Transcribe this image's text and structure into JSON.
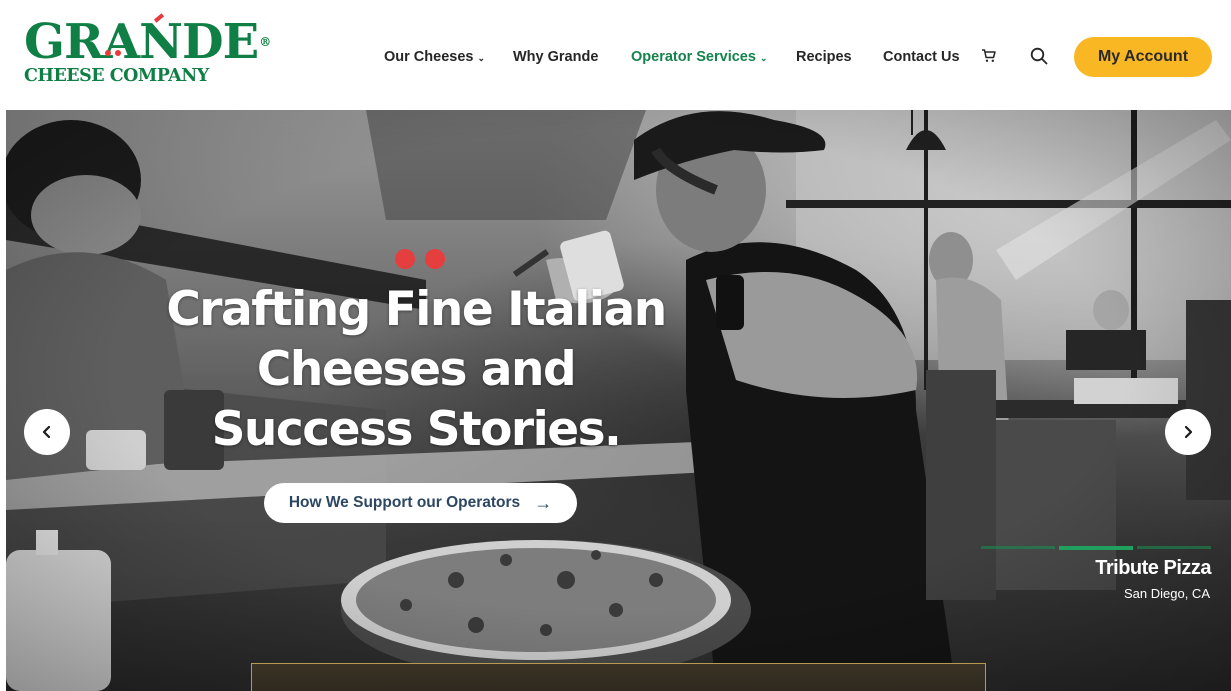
{
  "brand": {
    "name_top": "GRANDE",
    "name_bottom": "CHEESE COMPANY",
    "registered": "®",
    "colors": {
      "green": "#0f7f45",
      "red": "#e73b3b",
      "accent": "#f9b823"
    }
  },
  "nav": {
    "items": [
      {
        "label": "Our Cheeses",
        "has_menu": true
      },
      {
        "label": "Why Grande",
        "has_menu": false
      },
      {
        "label": "Operator Services",
        "has_menu": true,
        "active": true
      },
      {
        "label": "Recipes",
        "has_menu": false
      },
      {
        "label": "Contact Us",
        "has_menu": false
      }
    ],
    "chevron": "⌄",
    "cart_icon": "cart-icon",
    "search_icon": "search-icon",
    "account_label": "My Account"
  },
  "hero": {
    "headline": "Crafting Fine Italian Cheeses and Success Stories.",
    "cta_label": "How We Support our Operators",
    "cta_arrow": "→",
    "prev_icon": "chevron-left-icon",
    "next_icon": "chevron-right-icon",
    "caption_title": "Tribute Pizza",
    "caption_location": "San Diego, CA",
    "slides_total": 3,
    "slide_active": 2
  }
}
